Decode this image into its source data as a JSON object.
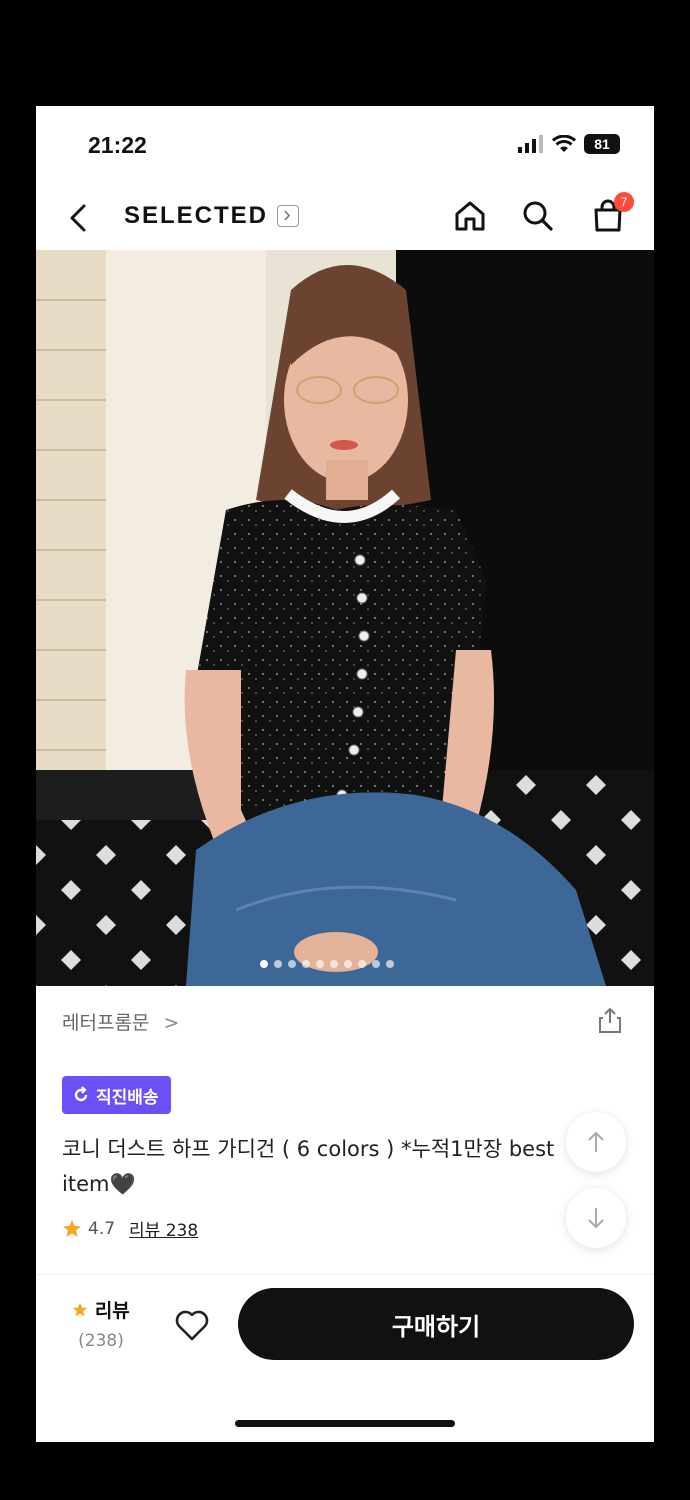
{
  "status": {
    "time": "21:22",
    "battery": "81"
  },
  "nav": {
    "brand": "SELECTED",
    "cart_count": "7",
    "icons": [
      "back-icon",
      "home-icon",
      "search-icon",
      "shopping-bag-icon"
    ]
  },
  "gallery": {
    "slide_count": 10,
    "active_index": 0
  },
  "product": {
    "store": "레터프롬문",
    "store_chevron": ">",
    "delivery_badge": "직진배송",
    "title": "코니 더스트 하프 가디건 ( 6 colors ) *누적1만장 best item🖤",
    "rating": "4.7",
    "review_label": "리뷰 238"
  },
  "bottom_bar": {
    "review_label": "리뷰",
    "review_count": "(238)",
    "buy_label": "구매하기"
  },
  "colors": {
    "accent_badge": "#6c4ff6",
    "star": "#f5a623",
    "cart_badge": "#ff4a3d",
    "button": "#111111"
  }
}
